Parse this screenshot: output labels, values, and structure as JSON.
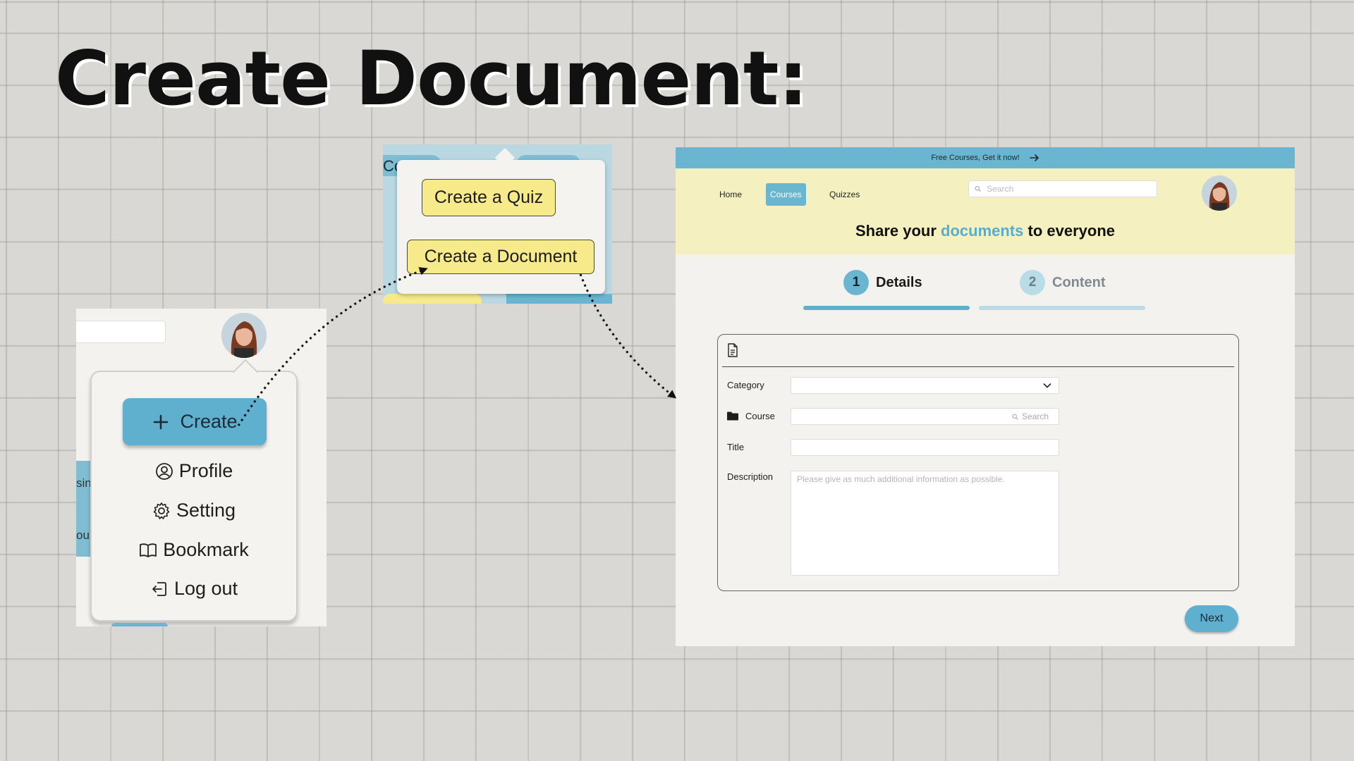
{
  "slide": {
    "title": "Create Document:"
  },
  "profile_menu": {
    "side_text_1": "sin",
    "side_text_2": "ou",
    "create_label": "Create",
    "items": [
      {
        "label": "Profile",
        "icon": "user-circle-icon"
      },
      {
        "label": "Setting",
        "icon": "gear-icon"
      },
      {
        "label": "Bookmark",
        "icon": "book-open-icon"
      },
      {
        "label": "Log out",
        "icon": "logout-icon"
      }
    ]
  },
  "create_popover": {
    "chip_text": "Co",
    "quiz_label": "Create a Quiz",
    "document_label": "Create a Document"
  },
  "document_page": {
    "announcement": "Free Courses, Get it now!",
    "nav": [
      "Home",
      "Courses",
      "Quizzes"
    ],
    "active_nav": "Courses",
    "search_placeholder": "Search",
    "headline_before": "Share your ",
    "headline_accent": "documents",
    "headline_after": " to everyone",
    "steps": [
      {
        "number": "1",
        "label": "Details",
        "active": true
      },
      {
        "number": "2",
        "label": "Content",
        "active": false
      }
    ],
    "form": {
      "category_label": "Category",
      "category_value": "",
      "course_label": "Course",
      "course_placeholder": "Search",
      "title_label": "Title",
      "title_value": "",
      "description_label": "Description",
      "description_placeholder": "Please give as much additional information as possible."
    },
    "next_label": "Next"
  },
  "colors": {
    "accent_blue": "#5fb0cf",
    "header_yellow": "#f5f0bf",
    "button_yellow": "#f7ea8b"
  }
}
